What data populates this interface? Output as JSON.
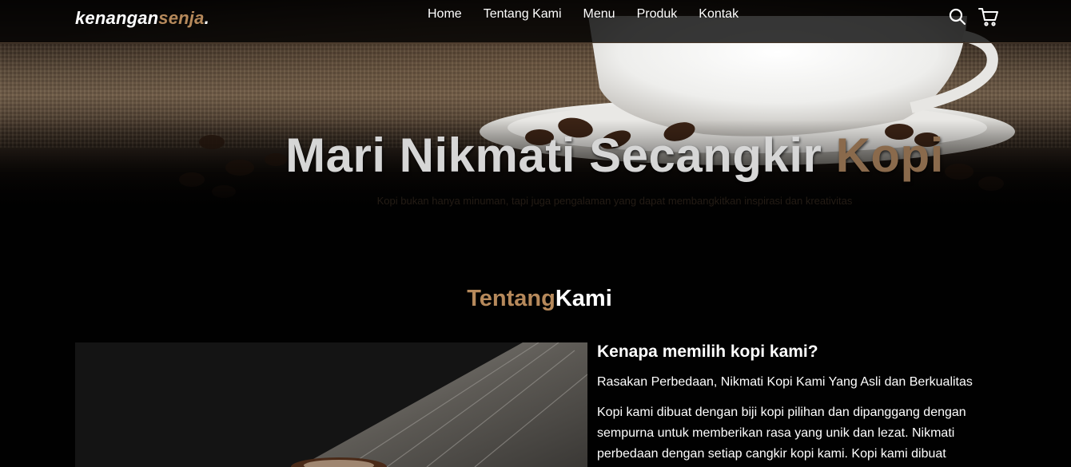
{
  "brand": {
    "part1": "kenangan",
    "part2": "senja",
    "part3": "."
  },
  "nav": {
    "items": [
      "Home",
      "Tentang Kami",
      "Menu",
      "Produk",
      "Kontak"
    ]
  },
  "icons": {
    "search": "search-icon",
    "cart": "shopping-cart-icon"
  },
  "hero": {
    "title_main": "Mari Nikmati Secangkir ",
    "title_accent": "Kopi",
    "subtitle": "Kopi bukan hanya minuman, tapi juga pengalaman yang dapat membangkitkan inspirasi dan kreativitas"
  },
  "about": {
    "title_part1": "Tentang",
    "title_part2": "Kami",
    "heading": "Kenapa memilih kopi kami?",
    "lead": "Rasakan Perbedaan, Nikmati Kopi Kami Yang Asli dan Berkualitas",
    "body": "Kopi kami dibuat dengan biji kopi pilihan dan dipanggang dengan sempurna untuk memberikan rasa yang unik dan lezat. Nikmati perbedaan dengan setiap cangkir kopi kami. Kopi kami dibuat"
  },
  "colors": {
    "accent": "#b6895b",
    "background": "#010101"
  }
}
